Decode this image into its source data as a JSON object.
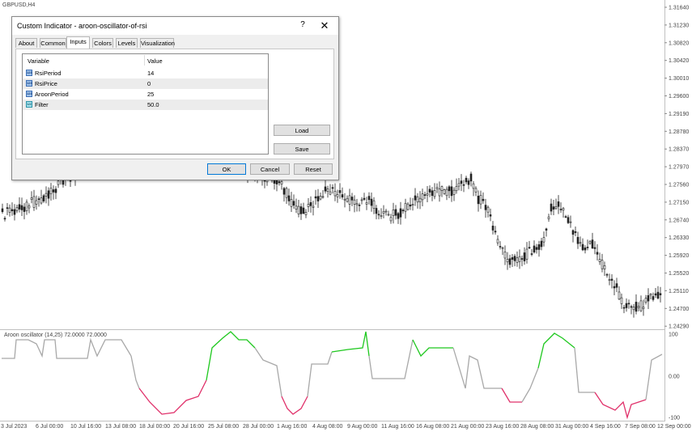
{
  "chart_window": {
    "symbol_label": "GBPUSD,H4",
    "price_axis": [
      "1.31640",
      "1.31230",
      "1.30820",
      "1.30420",
      "1.30010",
      "1.29600",
      "1.29190",
      "1.28780",
      "1.28370",
      "1.27970",
      "1.27560",
      "1.27150",
      "1.26740",
      "1.26330",
      "1.25920",
      "1.25520",
      "1.25110",
      "1.24700",
      "1.24290"
    ],
    "indicator_label": "Aroon oscillator (14,25) 72.0000 72.0000",
    "indicator_axis": [
      "100",
      "0.00",
      "-100"
    ],
    "time_axis": [
      "3 Jul 2023",
      "6 Jul 00:00",
      "10 Jul 16:00",
      "13 Jul 08:00",
      "18 Jul 00:00",
      "20 Jul 16:00",
      "25 Jul 08:00",
      "28 Jul 00:00",
      "1 Aug 16:00",
      "4 Aug 08:00",
      "9 Aug 00:00",
      "11 Aug 16:00",
      "16 Aug 08:00",
      "21 Aug 00:00",
      "23 Aug 16:00",
      "28 Aug 08:00",
      "31 Aug 00:00",
      "4 Sep 16:00",
      "7 Sep 08:00",
      "12 Sep 00:00"
    ],
    "colors": {
      "up": "#1ec81e",
      "down": "#e0306a",
      "neutral": "#a8a8a8",
      "candle": "#222222"
    }
  },
  "dialog": {
    "title": "Custom Indicator - aroon-oscillator-of-rsi",
    "help": "?",
    "close": "✕",
    "tabs": [
      "About",
      "Common",
      "Inputs",
      "Colors",
      "Levels",
      "Visualization"
    ],
    "active_tab": "Inputs",
    "columns": {
      "variable": "Variable",
      "value": "Value"
    },
    "inputs": [
      {
        "icon": "123",
        "name": "RsiPeriod",
        "value": "14"
      },
      {
        "icon": "123",
        "name": "RsiPrice",
        "value": "0"
      },
      {
        "icon": "123",
        "name": "AroonPeriod",
        "value": "25"
      },
      {
        "icon": "1/2",
        "name": "Filter",
        "value": "50.0"
      }
    ],
    "buttons": {
      "load": "Load",
      "save": "Save",
      "ok": "OK",
      "cancel": "Cancel",
      "reset": "Reset"
    }
  }
}
